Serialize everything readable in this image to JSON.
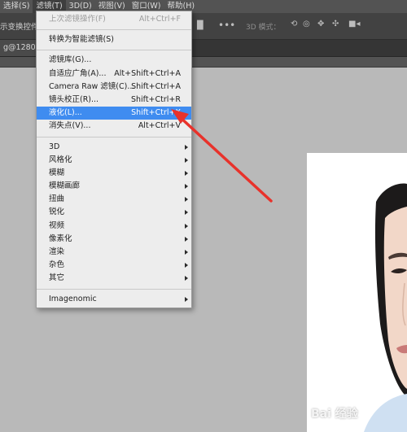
{
  "menubar": {
    "items": [
      {
        "label": "选择(S)"
      },
      {
        "label": "滤镜(T)",
        "active": true
      },
      {
        "label": "3D(D)"
      },
      {
        "label": "视图(V)"
      },
      {
        "label": "窗口(W)"
      },
      {
        "label": "帮助(H)"
      }
    ]
  },
  "options_bar": {
    "left_text": "示变换控件",
    "mode_label": "3D 模式："
  },
  "document_tab": {
    "label": "g@1280w"
  },
  "filter_menu": {
    "top": [
      {
        "label": "上次滤镜操作(F)",
        "shortcut": "Alt+Ctrl+F",
        "disabled": true
      }
    ],
    "group1": [
      {
        "label": "转换为智能滤镜(S)",
        "shortcut": ""
      }
    ],
    "group2": [
      {
        "label": "滤镜库(G)...",
        "shortcut": ""
      },
      {
        "label": "自适应广角(A)...",
        "shortcut": "Alt+Shift+Ctrl+A"
      },
      {
        "label": "Camera Raw 滤镜(C)...",
        "shortcut": "Shift+Ctrl+A"
      },
      {
        "label": "镜头校正(R)...",
        "shortcut": "Shift+Ctrl+R"
      },
      {
        "label": "液化(L)...",
        "shortcut": "Shift+Ctrl+X",
        "highlighted": true
      },
      {
        "label": "消失点(V)...",
        "shortcut": "Alt+Ctrl+V"
      }
    ],
    "group3": [
      {
        "label": "3D"
      },
      {
        "label": "风格化"
      },
      {
        "label": "模糊"
      },
      {
        "label": "模糊画廊"
      },
      {
        "label": "扭曲"
      },
      {
        "label": "锐化"
      },
      {
        "label": "视频"
      },
      {
        "label": "像素化"
      },
      {
        "label": "渲染"
      },
      {
        "label": "杂色"
      },
      {
        "label": "其它"
      }
    ],
    "group4": [
      {
        "label": "Imagenomic"
      }
    ]
  },
  "watermark": {
    "text": "Bai 经验"
  },
  "colors": {
    "highlight": "#3f8cf0",
    "annotation_arrow": "#e8322b",
    "menubar": "#535353",
    "canvas_bg": "#b9b9b9"
  }
}
